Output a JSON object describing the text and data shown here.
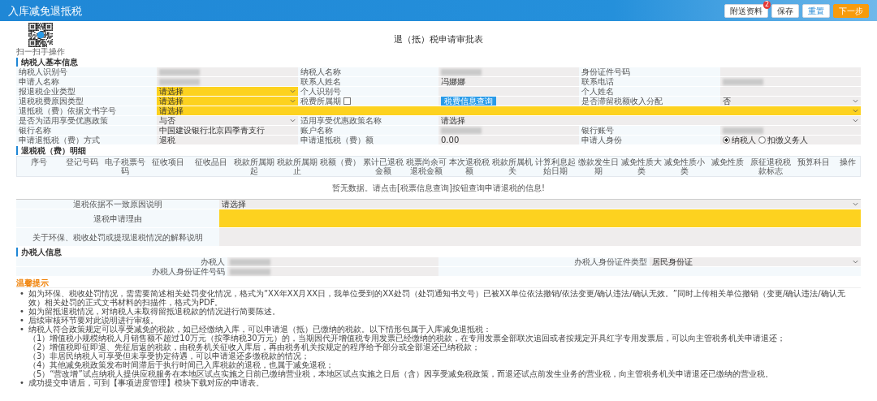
{
  "header": {
    "title": "入库减免退抵税",
    "buttons": [
      {
        "label": "附送资料",
        "kind": "default",
        "badge": "2"
      },
      {
        "label": "保存",
        "kind": "default"
      },
      {
        "label": "重置",
        "kind": "primary"
      },
      {
        "label": "下一步",
        "kind": "warning"
      }
    ]
  },
  "qr": {
    "caption": "扫一扫手操作"
  },
  "form_title": "退（抵）税申请审批表",
  "basic_info": {
    "title": "纳税人基本信息",
    "rows": [
      [
        {
          "kind": "label",
          "text": "纳税人识别号"
        },
        {
          "kind": "redacted"
        },
        {
          "kind": "label",
          "text": "纳税人名称"
        },
        {
          "kind": "redacted"
        },
        {
          "kind": "label",
          "text": "身份证件号码"
        },
        {
          "kind": "blank"
        }
      ],
      [
        {
          "kind": "label",
          "text": "申请人名称"
        },
        {
          "kind": "redacted"
        },
        {
          "kind": "label",
          "text": "联系人姓名"
        },
        {
          "kind": "value",
          "text": "冯娜娜"
        },
        {
          "kind": "label",
          "text": "联系电话"
        },
        {
          "kind": "redacted"
        }
      ],
      [
        {
          "kind": "label",
          "text": "报退税企业类型"
        },
        {
          "kind": "select",
          "text": "请选择",
          "required": true
        },
        {
          "kind": "label",
          "text": "个人识别号"
        },
        {
          "kind": "blank"
        },
        {
          "kind": "label",
          "text": "个人姓名"
        },
        {
          "kind": "blank"
        }
      ],
      [
        {
          "kind": "label",
          "text": "退税税费原因类型"
        },
        {
          "kind": "select",
          "text": "请选择",
          "required": true
        },
        {
          "kind": "checkbox",
          "text": "税费所属期",
          "checked": false
        },
        {
          "kind": "button",
          "text": "税费信息查询"
        },
        {
          "kind": "label",
          "text": "是否滞留税额收入分配"
        },
        {
          "kind": "select",
          "text": "否",
          "required": false
        }
      ],
      [
        {
          "kind": "label",
          "text": "退抵税（费）依据文书字号"
        },
        {
          "kind": "wide-select",
          "text": "请选择",
          "required": true
        }
      ],
      [
        {
          "kind": "label",
          "text": "是否为适用享受优惠政策"
        },
        {
          "kind": "select",
          "text": "与否",
          "required": false
        },
        {
          "kind": "label",
          "text": "适用享受优惠政策名称"
        },
        {
          "kind": "wide-select-half",
          "text": "请选择",
          "required": false
        }
      ],
      [
        {
          "kind": "label",
          "text": "银行名称"
        },
        {
          "kind": "value",
          "text": "中国建设银行北京四季青支行"
        },
        {
          "kind": "label",
          "text": "账户名称"
        },
        {
          "kind": "redacted"
        },
        {
          "kind": "label",
          "text": "银行账号"
        },
        {
          "kind": "redacted"
        }
      ],
      [
        {
          "kind": "label",
          "text": "申请退抵税（费）方式"
        },
        {
          "kind": "value",
          "text": "退税"
        },
        {
          "kind": "label",
          "text": "申请退抵税（费）额"
        },
        {
          "kind": "value",
          "text": "0.00"
        },
        {
          "kind": "label",
          "text": "申请人身份"
        },
        {
          "kind": "radio",
          "options": [
            {
              "label": "纳税人",
              "selected": true
            },
            {
              "label": "扣缴义务人",
              "selected": false
            }
          ]
        }
      ]
    ]
  },
  "refund_table": {
    "title": "退税税（费）明细",
    "columns": [
      "序号",
      "登记号码",
      "电子税票号码",
      "征收项目",
      "征收品目",
      "税款所属期起",
      "税款所属期止",
      "税额（费）",
      "累计已退税金额",
      "税票尚余可退税金额",
      "本次退税税额",
      "税款所属机关",
      "计算利息起始日期",
      "缴款发生日期",
      "减免性质大类",
      "减免性质小类",
      "减免性质",
      "原征退税税款标志",
      "预算科目",
      "操作"
    ],
    "empty_message": "暂无数据。请点击[税票信息查询]按钮查询申请退税的信息!"
  },
  "reason": {
    "rows": [
      {
        "label": "退税依据不一致原因说明",
        "kind": "select",
        "text": "请选择",
        "required": false
      },
      {
        "label": "退税申请理由",
        "kind": "textarea",
        "required": true
      },
      {
        "label": "关于环保、税收处罚或提现退税情况的解释说明",
        "kind": "textarea",
        "required": false
      }
    ]
  },
  "operator": {
    "title": "办税人信息",
    "rows": [
      [
        {
          "kind": "label",
          "text": "办税人"
        },
        {
          "kind": "redacted"
        },
        {
          "kind": "label",
          "text": "办税人身份证件类型"
        },
        {
          "kind": "select",
          "text": "居民身份证",
          "required": false
        }
      ],
      [
        {
          "kind": "label",
          "text": "办税人身份证件号码"
        },
        {
          "kind": "redacted"
        },
        {
          "kind": "blank"
        },
        {
          "kind": "blank"
        }
      ]
    ]
  },
  "notes": {
    "title": "温馨提示",
    "items": [
      {
        "marker": "•",
        "text": "如为环保、税收处罚情况，需需要简述相关处罚变化情况，格式为“XX年XX月XX日，我单位受到的XX处罚（处罚通知书文号）已被XX单位依法撤销/依法变更/确认违法/确认无效。”同时上传相关单位撤销（变更/确认违法/确认无效）相关处罚的正式文书材料的扫描件，格式为PDF。"
      },
      {
        "marker": "•",
        "text": "如为留抵退税情况，对纳税人未取得留抵退税款的情况进行简要陈述。"
      },
      {
        "marker": "•",
        "text": "后续审核环节要对此说明进行审核。"
      },
      {
        "marker": "•",
        "text": "纳税人符合政策规定可以享受减免的税款，如已经缴纳入库，可以申请退（抵）已缴纳的税款。以下情形包属于入库减免退抵税：",
        "children": [
          {
            "text": "（1）增值税小规模纳税人月销售额不超过10万元（按季纳税30万元）的，当期因代开增值税专用发票已经缴纳的税款，在专用发票全部联次追回或者按规定开具红字专用发票后，可以向主管税务机关申请退还；"
          },
          {
            "text": "（2）增值税即征即退、先征后返的税款，由税务机关征收入库后，再由税务机关按规定的程序给予部分或全部退还已纳税款；"
          },
          {
            "text": "（3）非居民纳税人可享受但未享受协定待遇，可以申请退还多缴税款的情况；"
          },
          {
            "text": "（4）其他减免税政策发布时间滞后于执行时间已入库税款的退税，也属于减免退税；"
          },
          {
            "text": "（5）“营改增”试点纳税人提供应税服务在本地区试点实施之日前已缴纳营业税，本地区试点实施之日后（含）因享受减免税政策，而退还试点前发生业务的营业税，向主管税务机关申请退还已缴纳的营业税。"
          }
        ]
      },
      {
        "marker": "•",
        "text": "成功提交申请后，可到【事项进度管理】模块下载对应的申请表。"
      }
    ]
  }
}
